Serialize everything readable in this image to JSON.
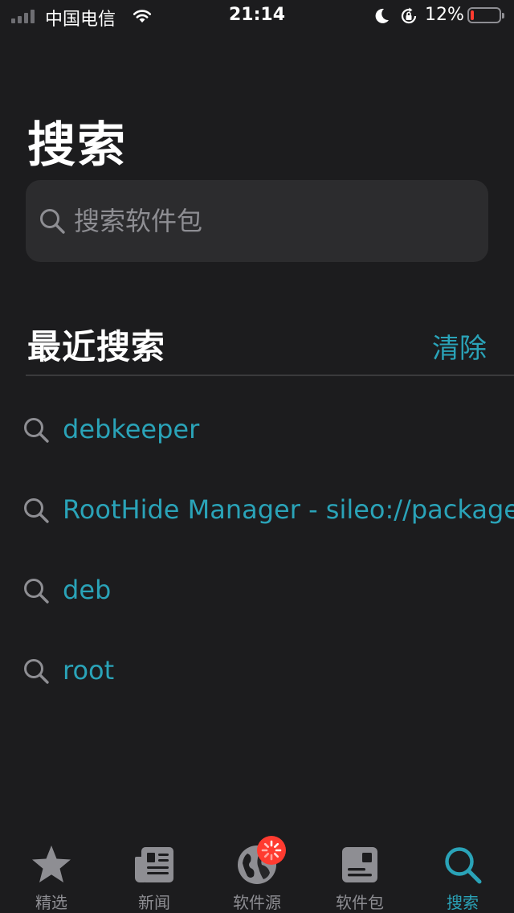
{
  "status_bar": {
    "carrier": "中国电信",
    "time": "21:14",
    "battery_percent": "12%",
    "battery_level": 0.12,
    "signal_bars": 4,
    "icons": [
      "signal-icon",
      "wifi-icon",
      "moon-icon",
      "rotation-lock-icon",
      "battery-icon"
    ]
  },
  "page": {
    "title": "搜索"
  },
  "search": {
    "placeholder": "搜索软件包",
    "value": "",
    "icon": "search-icon"
  },
  "recent": {
    "title": "最近搜索",
    "clear_label": "清除",
    "items": [
      {
        "label": "debkeeper"
      },
      {
        "label": "RootHide Manager - sileo://package/c"
      },
      {
        "label": "deb"
      },
      {
        "label": "root"
      }
    ]
  },
  "tab_bar": {
    "tabs": [
      {
        "label": "精选",
        "icon": "star-icon",
        "active": false
      },
      {
        "label": "新闻",
        "icon": "newspaper-icon",
        "active": false
      },
      {
        "label": "软件源",
        "icon": "globe-icon",
        "active": false,
        "badge": "loading"
      },
      {
        "label": "软件包",
        "icon": "package-icon",
        "active": false
      },
      {
        "label": "搜索",
        "icon": "search-icon",
        "active": true
      }
    ]
  },
  "colors": {
    "background": "#1c1c1e",
    "accent": "#2aa3b8",
    "secondary_text": "#8e8e93",
    "search_field": "#2c2c2e",
    "badge": "#ff3b30"
  }
}
